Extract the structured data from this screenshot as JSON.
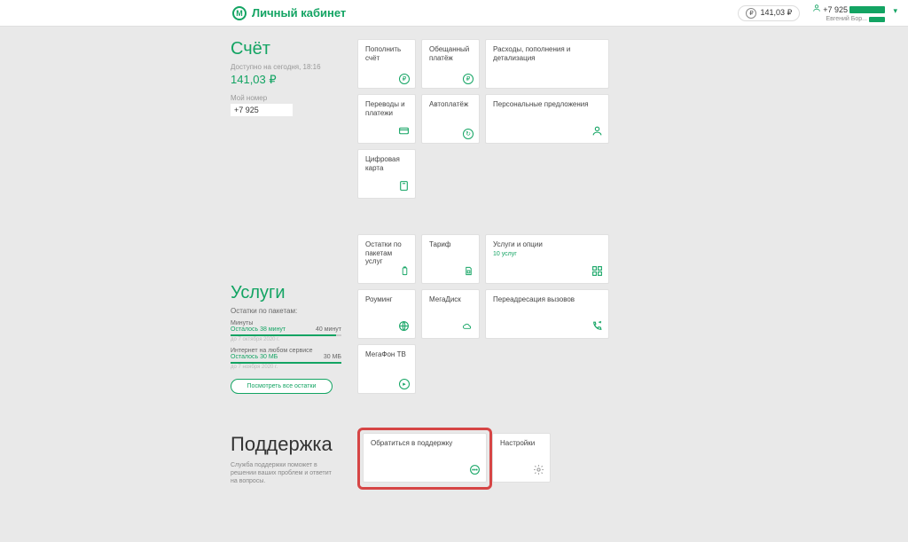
{
  "header": {
    "title": "Личный кабинет",
    "balance": "141,03 ₽",
    "user_phone_prefix": "+7 925",
    "user_name": "Евгений Бор..."
  },
  "account": {
    "title": "Счёт",
    "avail_label": "Доступно на сегодня, 18:16",
    "balance": "141,03 ₽",
    "my_number_label": "Мой номер",
    "my_number": "+7 925",
    "cards": {
      "topup": "Пополнить счёт",
      "promised": "Обещанный платёж",
      "expenses": "Расходы, пополнения и детализация",
      "transfers": "Переводы и платежи",
      "autopay": "Автоплатёж",
      "personal": "Персональные предложения",
      "digital_card": "Цифровая карта"
    }
  },
  "services": {
    "title": "Услуги",
    "sub": "Остатки по пакетам:",
    "minutes_label": "Минуты",
    "minutes_left": "Осталось 38 минут",
    "minutes_total": "40 минут",
    "minutes_until": "до 7 октября 2020 г.",
    "internet_label": "Интернет на любом сервисе",
    "internet_left": "Осталось 30 МБ",
    "internet_total": "30 МБ",
    "internet_until": "до 7 ноября 2020 г.",
    "view_all": "Посмотреть все остатки",
    "cards": {
      "remains": "Остатки по пакетам услуг",
      "tariff": "Тариф",
      "services_opts": "Услуги и опции",
      "services_opts_sub": "10 услуг",
      "roaming": "Роуминг",
      "megadisk": "МегаДиск",
      "forwarding": "Переадресация вызовов",
      "megafon_tv": "МегаФон ТВ"
    }
  },
  "support": {
    "title": "Поддержка",
    "desc": "Служба поддержки поможет в решении ваших проблем и ответит на вопросы.",
    "cards": {
      "contact": "Обратиться в поддержку",
      "settings": "Настройки"
    }
  }
}
